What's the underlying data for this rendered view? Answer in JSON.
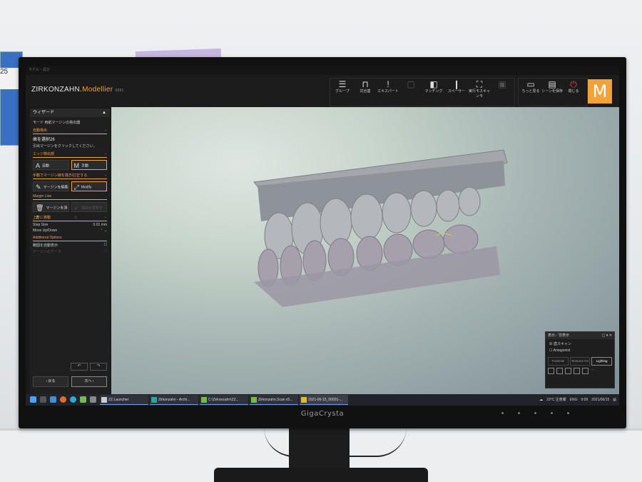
{
  "app": {
    "titlebar_text": "モデル・設計",
    "brand": "ZIRKONZAHN.",
    "brand_module": "Modellier",
    "version": "9081"
  },
  "toolbar": {
    "tools": [
      {
        "label": "グループ",
        "icon": "menu-icon"
      },
      {
        "label": "対合歯",
        "icon": "articulator-icon"
      },
      {
        "label": "エキスパート",
        "icon": "exclamation-icon"
      },
      {
        "label": "",
        "icon": "disabled-icon"
      },
      {
        "label": "マッチング",
        "icon": "matching-icon"
      },
      {
        "label": "スペーサー",
        "icon": "spacer-icon"
      },
      {
        "label": "実行モスキャンモ",
        "icon": "scan-icon"
      },
      {
        "label": "",
        "icon": "disabled-icon"
      }
    ],
    "right_tools": [
      {
        "label": "ちっと見る",
        "icon": "view-icon"
      },
      {
        "label": "シーンを保存",
        "icon": "save-icon"
      },
      {
        "label": "閉じる",
        "icon": "power-icon"
      }
    ],
    "logo_letter": "M"
  },
  "wizard": {
    "title": "ウィザード",
    "subtitle": "モード 用紙マージンの検出器",
    "auto_detect": {
      "title": "自動検出",
      "tooth": "歯を選択26",
      "hint": "引出マージンをクリックしてください。"
    },
    "edge_detect": {
      "title": "エッジ検出部",
      "auto": "自動",
      "manual": "手動"
    },
    "manual_edit": {
      "title": "手動でマージン線を描き/訂正する",
      "draw": "マージンを編集",
      "modify": "Modify"
    },
    "margin_line": {
      "title": "Margin Line",
      "delete": "マージンを消去",
      "disabled": "描画を更新する"
    },
    "updown": {
      "title": "上下に移動",
      "step_label": "Step Size",
      "step_value": "0.01",
      "step_unit": "mm",
      "move_label": "Move Up/Down"
    },
    "additional": {
      "title": "Additional Options",
      "opt1": "範囲を自動表示",
      "opt2": "マージンのデータ"
    },
    "back": "戻る",
    "next": "次へ"
  },
  "display_panel": {
    "title": "表示／非表示",
    "items": [
      "歯スキャン",
      "Antagonist"
    ],
    "tabs": [
      "TruSmile",
      "Textures On",
      "Lighting"
    ]
  },
  "taskbar": {
    "apps": [
      "ZZ.Launcher",
      "Zirkonzahn - Archi...",
      "C:\\Zirkonzahn\\ZZ...",
      "Zirkonzahn.Scan v5...",
      "2021-06-15_00001-..."
    ],
    "weather": "23°C 注意報",
    "lang": "ENG",
    "time": "9:09",
    "date": "2021/06/15"
  },
  "monitor": {
    "brand": "GigaCrysta"
  },
  "wall": {
    "note_text": "25"
  },
  "colors": {
    "accent": "#f0a23b",
    "bg": "#1c1c1c"
  }
}
